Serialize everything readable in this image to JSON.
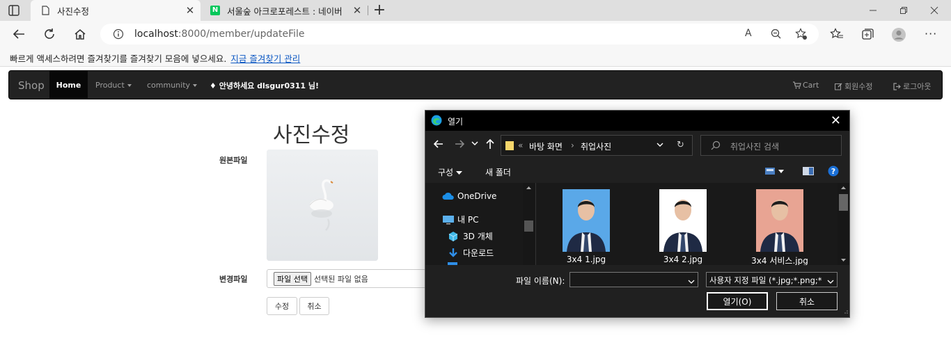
{
  "browser": {
    "tabs": [
      {
        "title": "사진수정",
        "active": true
      },
      {
        "title": "서울숲 아크로포레스트 : 네이버",
        "active": false
      }
    ],
    "url_host": "localhost",
    "url_rest": ":8000/member/updateFile",
    "favorites_bar": {
      "message": "빠르게 액세스하려면 즐겨찾기를 즐겨찾기 모음에 넣으세요.",
      "link": "지금 즐겨찾기 관리"
    },
    "naver_favicon_letter": "N",
    "reader_label": "A"
  },
  "navbar": {
    "brand": "Shop",
    "home": "Home",
    "product": "Product",
    "community": "community",
    "greeting": "안녕하세요 dlsgur0311 님!",
    "cart": "Cart",
    "edit_member": "회원수정",
    "logout": "로그아웃"
  },
  "form": {
    "title": "사진수정",
    "original_label": "원본파일",
    "change_label": "변경파일",
    "choose_file": "파일 선택",
    "no_file": "선택된 파일 없음",
    "submit": "수정",
    "cancel": "취소"
  },
  "dialog": {
    "title": "열기",
    "path_prefix": "«",
    "path": [
      "바탕 화면",
      "취업사진"
    ],
    "search_placeholder": "취업사진 검색",
    "organize": "구성",
    "new_folder": "새 폴더",
    "tree": [
      "OneDrive",
      "내 PC",
      "3D 개체",
      "다운로드"
    ],
    "files": [
      {
        "name": "3x4 1.jpg",
        "bg": "#5aa8e8"
      },
      {
        "name": "3x4 2.jpg",
        "bg": "#ffffff"
      },
      {
        "name": "3x4 서비스.jpg",
        "bg": "#e8a493"
      }
    ],
    "filename_label": "파일 이름(N):",
    "filter": "사용자 지정 파일 (*.jpg;*.png;*",
    "open_button": "열기(O)",
    "cancel_button": "취소"
  },
  "colors": {
    "navbar_bg": "#222222",
    "dialog_bg": "#202020",
    "link": "#0b57c3"
  }
}
